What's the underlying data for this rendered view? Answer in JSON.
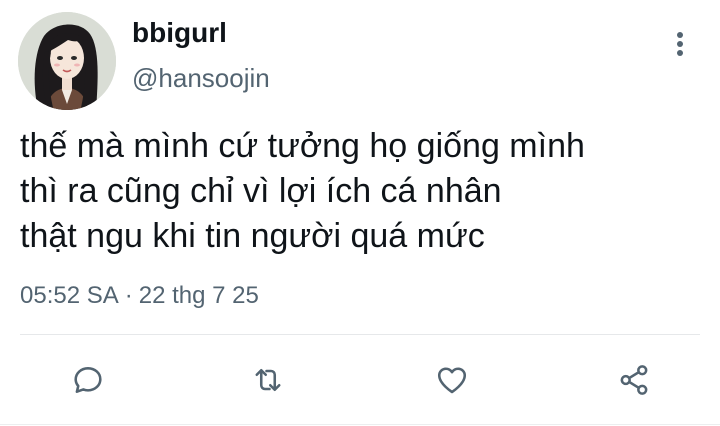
{
  "author": {
    "display_name": "bbigurl",
    "handle": "@hansoojin"
  },
  "tweet": {
    "text": "thế mà mình cứ tưởng họ giống mình\nthì ra cũng chỉ vì lợi ích cá nhân\nthật ngu khi tin người quá mức",
    "time": "05:52 SA",
    "separator": "·",
    "date": "22 thg 7 25"
  },
  "actions": [
    "reply-icon",
    "retweet-icon",
    "like-icon",
    "share-icon"
  ],
  "colors": {
    "text_primary": "#0f1419",
    "text_secondary": "#536471",
    "icon": "#536471"
  }
}
